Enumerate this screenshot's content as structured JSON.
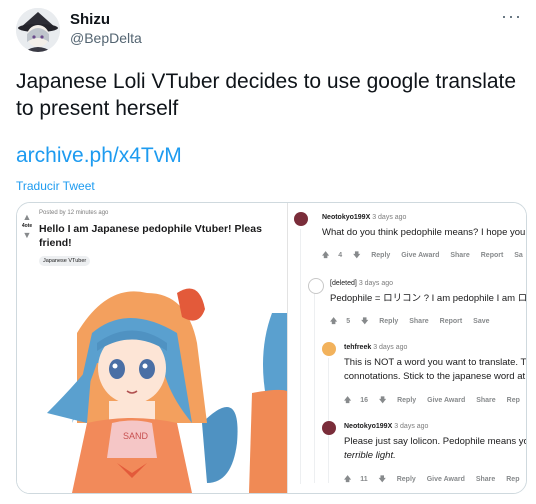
{
  "tweet": {
    "author_name": "Shizu",
    "author_handle": "@BepDelta",
    "more_icon": "more-icon",
    "text": "Japanese Loli VTuber decides to use google translate to present herself",
    "link": "archive.ph/x4TvM",
    "translate_label": "Traducir Tweet"
  },
  "embedded_screenshot": {
    "post": {
      "score": "4ote",
      "meta": "Posted by 12 minutes ago",
      "title_line1": "Hello I am Japanese pedophile Vtuber! Pleas",
      "title_line2": "friend!",
      "flair": "Japanese VTuber"
    },
    "comments": [
      {
        "author": "Neotokyo199X",
        "time": "3 days ago",
        "body": [
          "What do you think pedophile means? I hope you"
        ],
        "votes": "4",
        "actions": [
          "Reply",
          "Give Award",
          "Share",
          "Report",
          "Sa"
        ]
      },
      {
        "author": "[deleted]",
        "time": "3 days ago",
        "body": [
          "Pedophile = ロリコン ? I am pedophile I am ロ"
        ],
        "votes": "5",
        "actions": [
          "Reply",
          "Share",
          "Report",
          "Save"
        ]
      },
      {
        "author": "tehfreek",
        "time": "3 days ago",
        "body": [
          "This is NOT a word you want to translate. Th",
          "connotations. Stick to the japanese word at"
        ],
        "votes": "16",
        "actions": [
          "Reply",
          "Give Award",
          "Share",
          "Rep"
        ]
      },
      {
        "author": "Neotokyo199X",
        "time": "3 days ago",
        "body": [
          "Please just say lolicon. Pedophile means yo",
          "terrible light."
        ],
        "votes": "11",
        "actions": [
          "Reply",
          "Give Award",
          "Share",
          "Rep"
        ]
      }
    ]
  }
}
